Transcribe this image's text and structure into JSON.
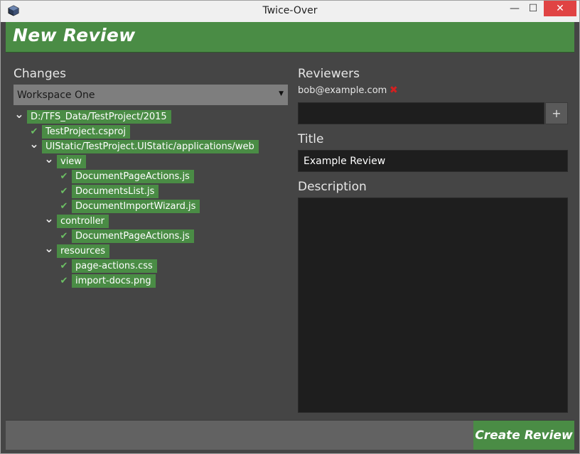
{
  "window": {
    "title": "Twice-Over",
    "app_icon": "cube-app-icon",
    "controls": {
      "minimize": "—",
      "maximize": "☐",
      "close": "✕"
    }
  },
  "header": {
    "title": "New Review"
  },
  "changes": {
    "label": "Changes",
    "workspace_selected": "Workspace One",
    "tree": [
      {
        "label": "D:/TFS_Data/TestProject/2015",
        "kind": "folder",
        "expanded": true,
        "depth": 0
      },
      {
        "label": "TestProject.csproj",
        "kind": "file",
        "checked": true,
        "depth": 1
      },
      {
        "label": "UIStatic/TestProject.UIStatic/applications/web",
        "kind": "folder",
        "expanded": true,
        "depth": 1
      },
      {
        "label": "view",
        "kind": "folder",
        "expanded": true,
        "depth": 2
      },
      {
        "label": "DocumentPageActions.js",
        "kind": "file",
        "checked": true,
        "depth": 3
      },
      {
        "label": "DocumentsList.js",
        "kind": "file",
        "checked": true,
        "depth": 3
      },
      {
        "label": "DocumentImportWizard.js",
        "kind": "file",
        "checked": true,
        "depth": 3
      },
      {
        "label": "controller",
        "kind": "folder",
        "expanded": true,
        "depth": 2
      },
      {
        "label": "DocumentPageActions.js",
        "kind": "file",
        "checked": true,
        "depth": 3
      },
      {
        "label": "resources",
        "kind": "folder",
        "expanded": true,
        "depth": 2
      },
      {
        "label": "page-actions.css",
        "kind": "file",
        "checked": true,
        "depth": 3
      },
      {
        "label": "import-docs.png",
        "kind": "file",
        "checked": true,
        "depth": 3
      }
    ]
  },
  "reviewers": {
    "label": "Reviewers",
    "list": [
      "bob@example.com"
    ],
    "remove_glyph": "✖",
    "input_value": "",
    "add_label": "+"
  },
  "title_field": {
    "label": "Title",
    "value": "Example Review"
  },
  "description": {
    "label": "Description",
    "value": ""
  },
  "footer": {
    "create_label": "Create Review"
  },
  "colors": {
    "accent": "#4a8c45",
    "background": "#454545",
    "field": "#1e1e1e",
    "remove": "#d42020"
  }
}
